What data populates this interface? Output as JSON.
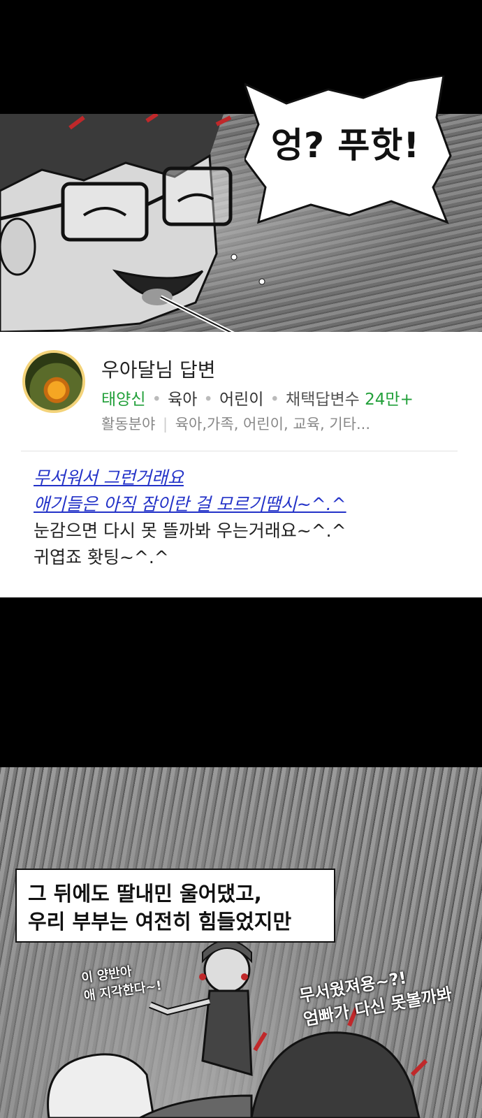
{
  "top_panel": {
    "speech": "엉? 푸핫!"
  },
  "answer_card": {
    "author": "우아달님 답변",
    "rank": "태양신",
    "tags": [
      "육아",
      "어린이"
    ],
    "adopted_label": "채택답변수",
    "adopted_count": "24만+",
    "fields_label": "활동분야",
    "fields": "육아,가족, 어린이, 교육,  기타...",
    "answer_lines": [
      "무서워서 그런거래요",
      "애기들은 아직 잠이란 걸 모르기땜시~^.^",
      "눈감으면 다시 못 뜰까봐 우는거래요~^.^",
      "귀엽죠 홧팅~^.^"
    ],
    "colors": {
      "rank": "#22a03a",
      "count": "#22a03a",
      "link": "#2332c8"
    }
  },
  "bottom_panel": {
    "caption_lines": [
      "그 뒤에도 딸내민 울어댔고,",
      "우리 부부는 여전히 힘들었지만"
    ],
    "handwritten_left": [
      "이 양반아",
      "애 지각한다~!"
    ],
    "handwritten_right": [
      "무서웠져용~?!",
      "엄빠가 다신 못볼까봐"
    ]
  }
}
